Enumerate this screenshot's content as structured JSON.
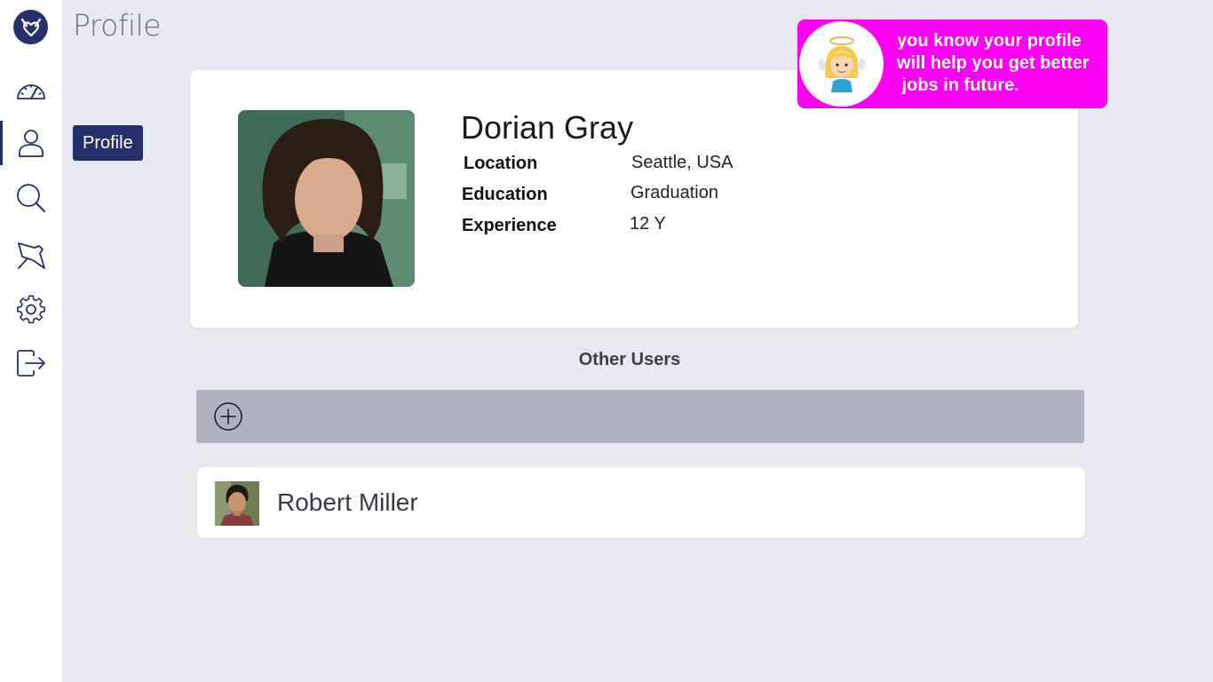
{
  "page": {
    "title": "Profile"
  },
  "sidebar": {
    "logo_icon": "handshake-heart-icon",
    "items": [
      {
        "id": "dashboard",
        "icon": "speedometer-icon",
        "active": false
      },
      {
        "id": "profile",
        "icon": "user-icon",
        "active": true,
        "tooltip": "Profile"
      },
      {
        "id": "search",
        "icon": "search-icon",
        "active": false
      },
      {
        "id": "pinned",
        "icon": "pin-icon",
        "active": false
      },
      {
        "id": "settings",
        "icon": "gear-icon",
        "active": false
      },
      {
        "id": "logout",
        "icon": "logout-icon",
        "active": false
      }
    ]
  },
  "profile": {
    "name": "Dorian Gray",
    "fields": [
      {
        "label": "Location",
        "value": "Seattle, USA"
      },
      {
        "label": "Education",
        "value": "Graduation"
      },
      {
        "label": "Experience",
        "value": "12 Y"
      }
    ]
  },
  "hint": {
    "lines": [
      "you know your profile",
      "will help you get better",
      " jobs in future."
    ],
    "icon": "angel-icon",
    "color": "#ff00f4"
  },
  "other_users": {
    "title": "Other Users",
    "add_icon": "plus-circle-icon",
    "users": [
      {
        "name": "Robert Miller"
      }
    ]
  },
  "colors": {
    "brand": "#24306b",
    "background": "#e8e8f1",
    "add_bar": "#b0b1c2",
    "hint": "#ff00f4"
  }
}
